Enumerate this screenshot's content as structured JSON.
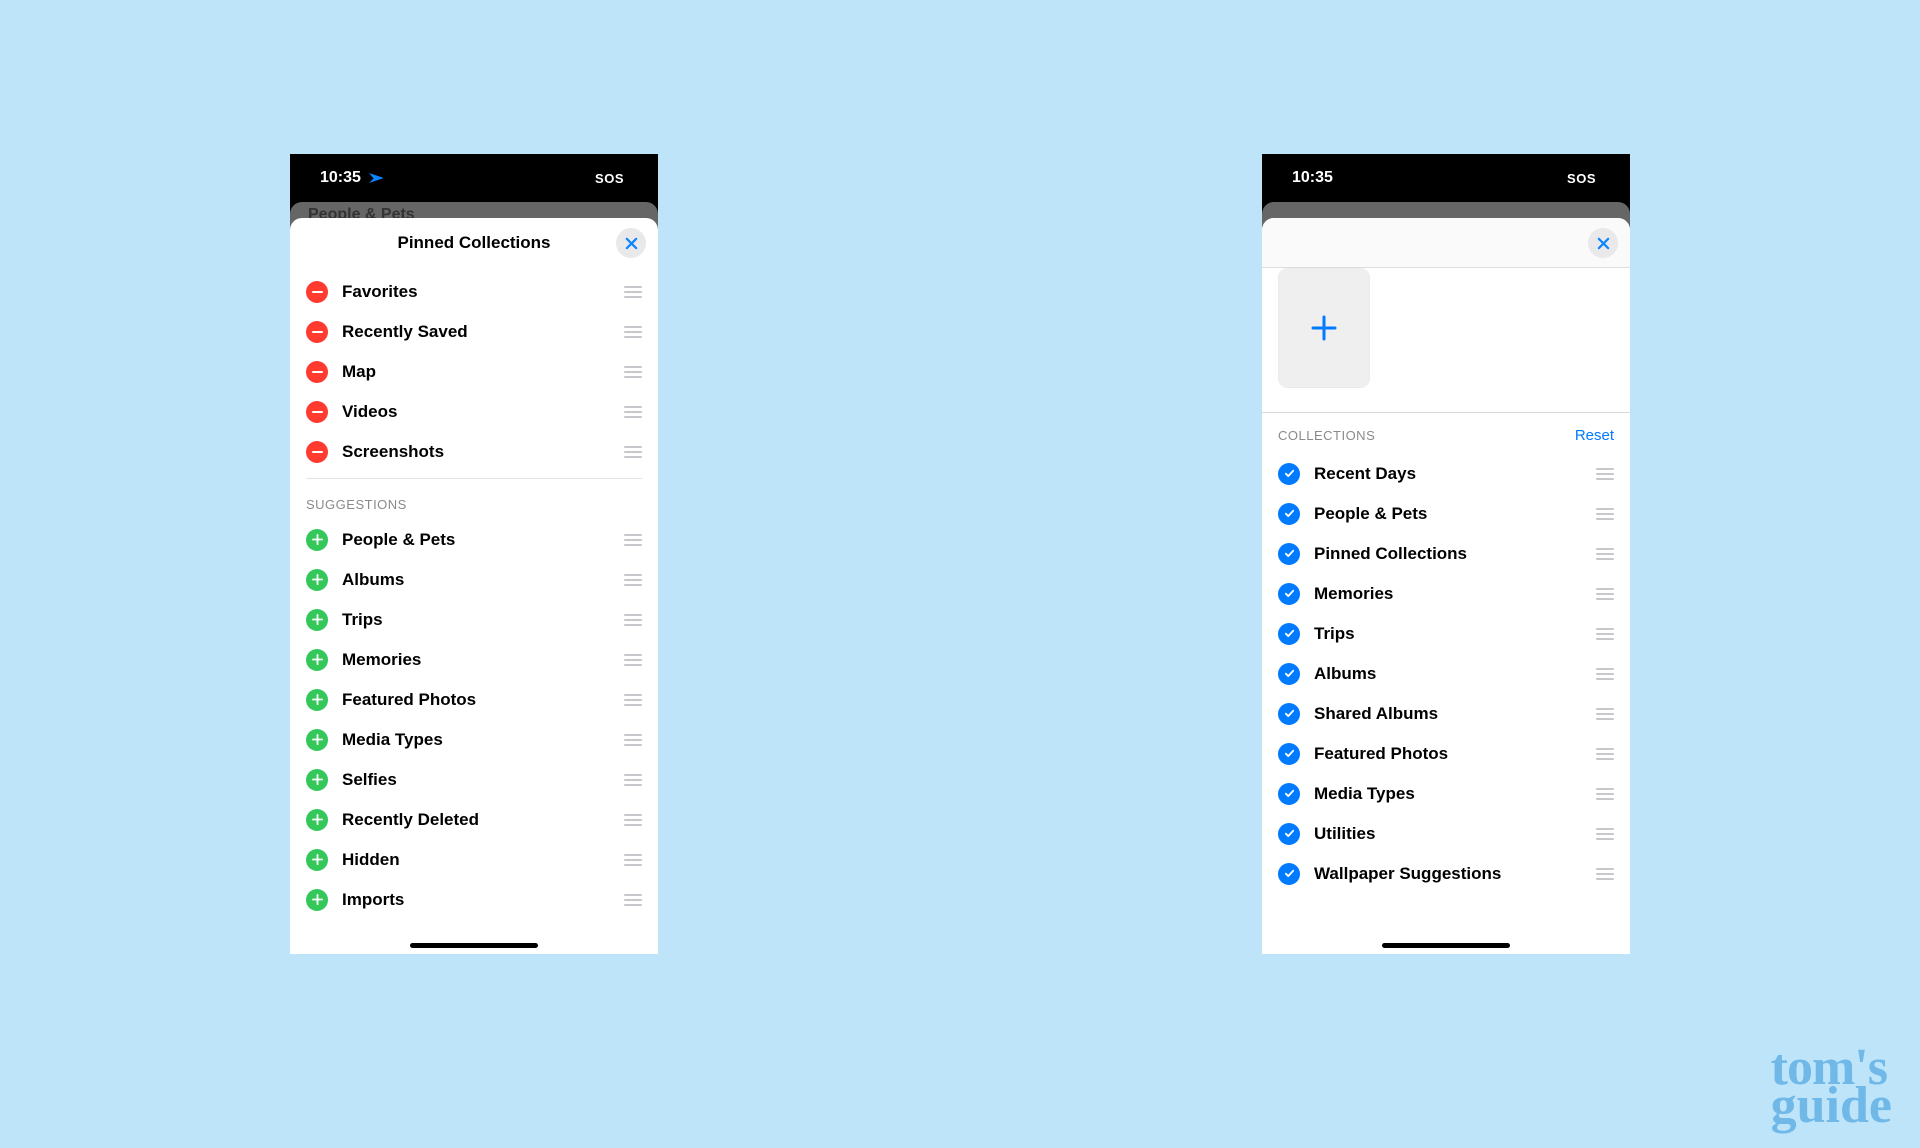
{
  "statusbar": {
    "time": "10:35",
    "sos": "SOS"
  },
  "watermark": {
    "line1": "tom's",
    "line2": "guide"
  },
  "left": {
    "peek": "People & Pets",
    "title": "Pinned Collections",
    "pinned": [
      {
        "label": "Favorites"
      },
      {
        "label": "Recently Saved"
      },
      {
        "label": "Map"
      },
      {
        "label": "Videos"
      },
      {
        "label": "Screenshots"
      }
    ],
    "suggestions_label": "SUGGESTIONS",
    "suggestions": [
      {
        "label": "People & Pets"
      },
      {
        "label": "Albums"
      },
      {
        "label": "Trips"
      },
      {
        "label": "Memories"
      },
      {
        "label": "Featured Photos"
      },
      {
        "label": "Media Types"
      },
      {
        "label": "Selfies"
      },
      {
        "label": "Recently Deleted"
      },
      {
        "label": "Hidden"
      },
      {
        "label": "Imports"
      }
    ]
  },
  "right": {
    "collections_label": "COLLECTIONS",
    "reset_label": "Reset",
    "collections": [
      {
        "label": "Recent Days"
      },
      {
        "label": "People & Pets"
      },
      {
        "label": "Pinned Collections"
      },
      {
        "label": "Memories"
      },
      {
        "label": "Trips"
      },
      {
        "label": "Albums"
      },
      {
        "label": "Shared Albums"
      },
      {
        "label": "Featured Photos"
      },
      {
        "label": "Media Types"
      },
      {
        "label": "Utilities"
      },
      {
        "label": "Wallpaper Suggestions"
      }
    ]
  }
}
